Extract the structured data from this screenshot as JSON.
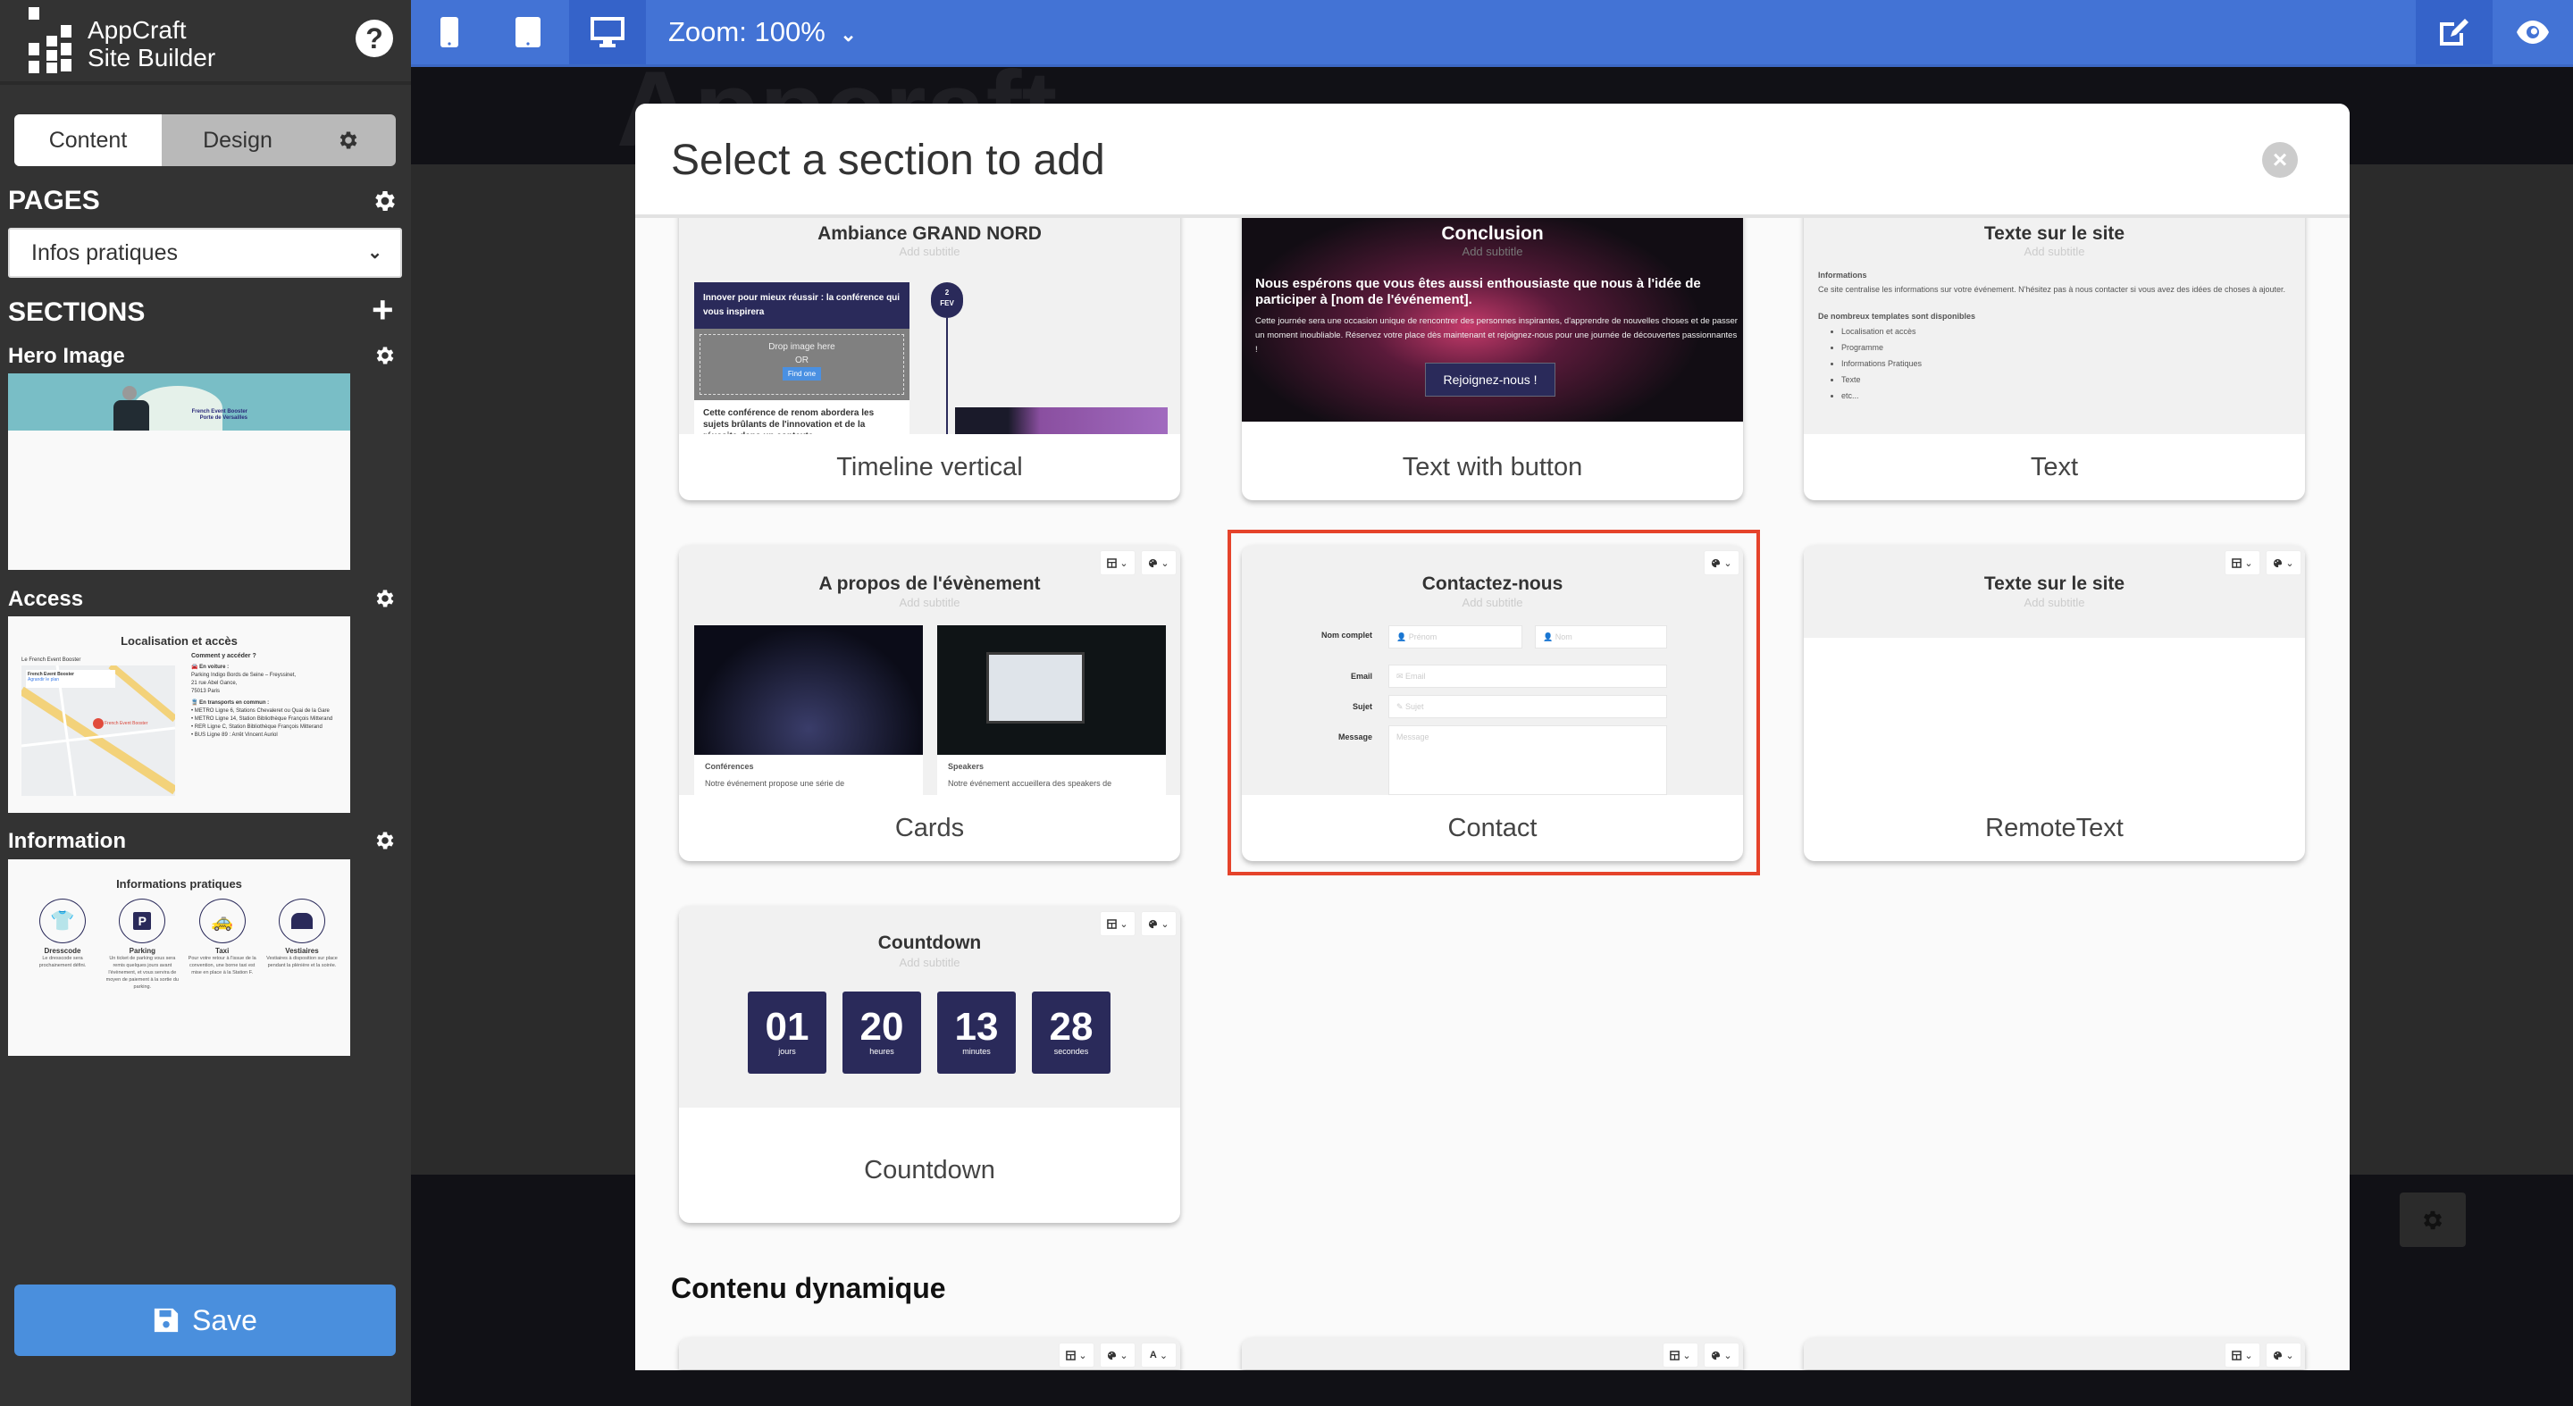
{
  "app": {
    "name_line1": "AppCraft",
    "name_line2": "Site Builder",
    "help_label": "?"
  },
  "sidebar": {
    "tabs": [
      {
        "label": "Content",
        "active": true
      },
      {
        "label": "Design",
        "active": false
      }
    ],
    "pages_heading": "PAGES",
    "page_select": {
      "value": "Infos pratiques"
    },
    "sections_heading": "SECTIONS",
    "sections": [
      {
        "label": "Hero Image",
        "thumb": {
          "line1": "French Event Booster",
          "line2": "Porte de Versailles"
        }
      },
      {
        "label": "Access",
        "thumb": {
          "title": "Localisation et accès",
          "map_caption": "Le French Event Booster",
          "map_card_title": "French Event Booster",
          "map_card_link": "Agrandir le plan",
          "map_pin": "French Event Booster",
          "how": "Comment y accéder ?",
          "car_heading": "En voiture :",
          "car_lines": [
            "Parking Indigo Bords de Seine – Freyssinet,",
            "21 rue Abel Gance,",
            "75013 Paris"
          ],
          "transit_heading": "En transports en commun :",
          "transit_items": [
            "METRO Ligne 6, Stations Chevaleret ou Quai de la Gare",
            "METRO Ligne 14, Station Bibliothèque François Mitterand",
            "RER Ligne C, Station Bibliothèque François Mitterand",
            "BUS Ligne 89 : Arrêt Vincent Auriol"
          ]
        }
      },
      {
        "label": "Information",
        "thumb": {
          "title": "Informations pratiques",
          "items": [
            {
              "name": "Dresscode",
              "text": "Le dresscode sera prochainement défini.",
              "icon": "tshirt-icon"
            },
            {
              "name": "Parking",
              "text": "Un ticket de parking vous sera remis quelques jours avant l'évènement, et vous servira de moyen de paiement à la sortie du parking.",
              "icon": "parking-icon"
            },
            {
              "name": "Taxi",
              "text": "Pour votre retour à l'issue de la convention, une borne taxi est mise en place à la Station F.",
              "icon": "taxi-icon"
            },
            {
              "name": "Vestiaires",
              "text": "Vestiaires à disposition sur place pendant la plénière et la soirée.",
              "icon": "warehouse-icon"
            }
          ]
        }
      }
    ],
    "save_label": "Save"
  },
  "topbar": {
    "devices": [
      "mobile",
      "tablet",
      "desktop"
    ],
    "selected_device": "desktop",
    "zoom_label": "Zoom: 100%",
    "right_buttons": [
      "edit",
      "preview"
    ],
    "selected_right": "edit"
  },
  "background": {
    "logo_text": "Appcraft"
  },
  "modal": {
    "title": "Select a section to add",
    "cards": [
      {
        "label": "Timeline vertical",
        "preview": {
          "title": "Ambiance GRAND NORD",
          "subtitle": "Add subtitle",
          "item_title": "Innover pour mieux réussir : la conférence qui vous inspirera",
          "drop_text": "Drop image here",
          "or_text": "OR",
          "find_label": "Find one",
          "date_day": "2",
          "date_month": "FEV",
          "body": "Cette conférence de renom abordera les sujets brûlants de l'innovation et de la réussite dans un contexte"
        }
      },
      {
        "label": "Text with button",
        "preview": {
          "title": "Conclusion",
          "subtitle": "Add subtitle",
          "headline": "Nous espérons que vous êtes aussi enthousiaste que nous à l'idée de participer à [nom de l'événement].",
          "body": "Cette journée sera une occasion unique de rencontrer des personnes inspirantes, d'apprendre de nouvelles choses et de passer un moment inoubliable. Réservez votre place dès maintenant et rejoignez-nous pour une journée de découvertes passionnantes !",
          "button": "Rejoignez-nous !"
        }
      },
      {
        "label": "Text",
        "preview": {
          "title": "Texte sur le site",
          "subtitle": "Add subtitle",
          "h1": "Informations",
          "p1": "Ce site centralise les informations sur votre événement. N'hésitez pas à nous contacter si vous avez des idées de choses à ajouter.",
          "h2": "De nombreux templates sont disponibles",
          "list": [
            "Localisation et accès",
            "Programme",
            "Informations Pratiques",
            "Texte",
            "etc..."
          ]
        }
      },
      {
        "label": "Cards",
        "preview": {
          "title": "A propos de l'évènement",
          "subtitle": "Add subtitle",
          "items": [
            {
              "title": "Conférences",
              "text": "Notre événement propose une série de"
            },
            {
              "title": "Speakers",
              "text": "Notre événement accueillera des speakers de"
            }
          ]
        }
      },
      {
        "label": "Contact",
        "highlighted": true,
        "preview": {
          "title": "Contactez-nous",
          "subtitle": "Add subtitle",
          "name_label": "Nom complet",
          "first_ph": "Prénom",
          "last_ph": "Nom",
          "email_label": "Email",
          "email_ph": "Email",
          "subject_label": "Sujet",
          "subject_ph": "Sujet",
          "message_label": "Message",
          "message_ph": "Message"
        }
      },
      {
        "label": "RemoteText",
        "preview": {
          "title": "Texte sur le site",
          "subtitle": "Add subtitle"
        }
      },
      {
        "label": "Countdown",
        "preview": {
          "title": "Countdown",
          "subtitle": "Add subtitle",
          "units": [
            {
              "value": "01",
              "unit": "jours"
            },
            {
              "value": "20",
              "unit": "heures"
            },
            {
              "value": "13",
              "unit": "minutes"
            },
            {
              "value": "28",
              "unit": "secondes"
            }
          ]
        }
      }
    ],
    "dynamic_heading": "Contenu dynamique",
    "highlight_color": "#e5432b",
    "accent_color": "#2a2a5a"
  }
}
